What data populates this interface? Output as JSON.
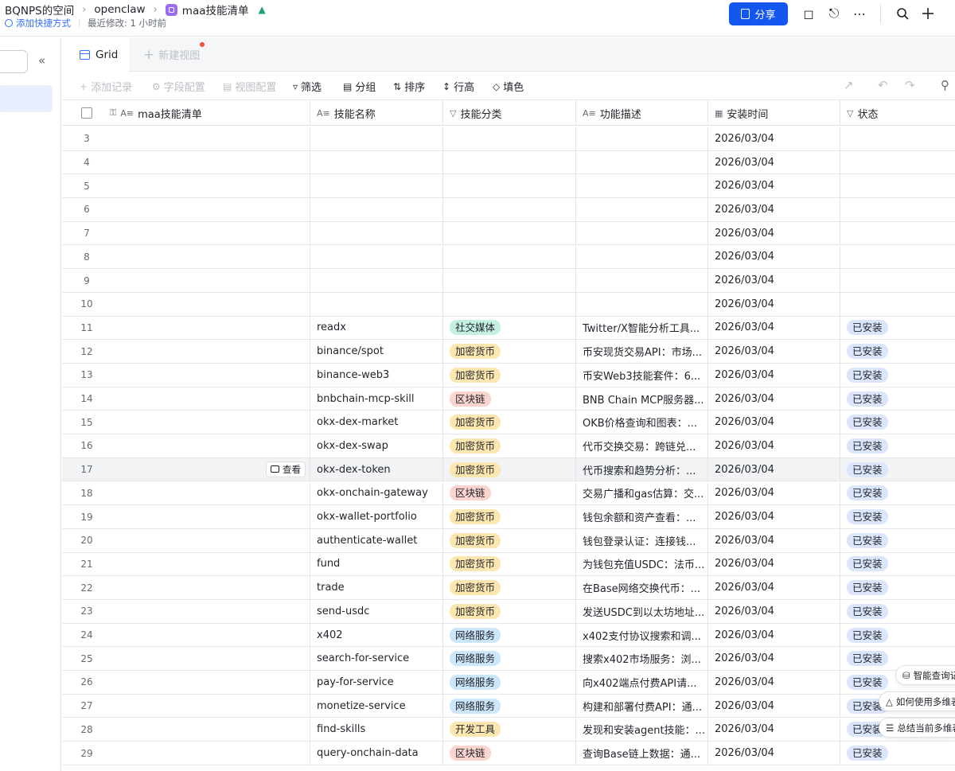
{
  "header": {
    "breadcrumb": [
      "BQNPS的空间",
      "openclaw",
      "maa技能清单"
    ],
    "add_shortcut": "添加快捷方式",
    "last_modified": "最近修改: 1 小时前",
    "share_label": "分享"
  },
  "views": {
    "active": "Grid",
    "new_view": "新建视图"
  },
  "toolbar": {
    "add_record": "添加记录",
    "field_config": "字段配置",
    "view_config": "视图配置",
    "filter": "筛选",
    "group": "分组",
    "sort": "排序",
    "row_height": "行高",
    "fill_color": "填色"
  },
  "columns": [
    "maa技能清单",
    "技能名称",
    "技能分类",
    "功能描述",
    "安装时间",
    "状态"
  ],
  "colors": {
    "accent": "#1456f0",
    "tag_social": "#c4efe3",
    "tag_crypto": "#fde7b0",
    "tag_chain": "#fbd4d0",
    "tag_net": "#cce6fb",
    "tag_dev": "#fde7b0",
    "tag_installed": "#dbe5fb"
  },
  "rows": [
    {
      "n": "3",
      "name": "",
      "cat": "",
      "desc": "",
      "date": "2026/03/04",
      "status": ""
    },
    {
      "n": "4",
      "name": "",
      "cat": "",
      "desc": "",
      "date": "2026/03/04",
      "status": ""
    },
    {
      "n": "5",
      "name": "",
      "cat": "",
      "desc": "",
      "date": "2026/03/04",
      "status": ""
    },
    {
      "n": "6",
      "name": "",
      "cat": "",
      "desc": "",
      "date": "2026/03/04",
      "status": ""
    },
    {
      "n": "7",
      "name": "",
      "cat": "",
      "desc": "",
      "date": "2026/03/04",
      "status": ""
    },
    {
      "n": "8",
      "name": "",
      "cat": "",
      "desc": "",
      "date": "2026/03/04",
      "status": ""
    },
    {
      "n": "9",
      "name": "",
      "cat": "",
      "desc": "",
      "date": "2026/03/04",
      "status": ""
    },
    {
      "n": "10",
      "name": "",
      "cat": "",
      "desc": "",
      "date": "2026/03/04",
      "status": ""
    },
    {
      "n": "11",
      "name": "readx",
      "cat": "社交媒体",
      "cat_color": "#c4efe3",
      "desc": "Twitter/X智能分析工具...",
      "date": "2026/03/04",
      "status": "已安装"
    },
    {
      "n": "12",
      "name": "binance/spot",
      "cat": "加密货币",
      "cat_color": "#fde7b0",
      "desc": "币安现货交易API：市场...",
      "date": "2026/03/04",
      "status": "已安装"
    },
    {
      "n": "13",
      "name": "binance-web3",
      "cat": "加密货币",
      "cat_color": "#fde7b0",
      "desc": "币安Web3技能套件：6...",
      "date": "2026/03/04",
      "status": "已安装"
    },
    {
      "n": "14",
      "name": "bnbchain-mcp-skill",
      "cat": "区块链",
      "cat_color": "#fbd4d0",
      "desc": "BNB Chain MCP服务器...",
      "date": "2026/03/04",
      "status": "已安装"
    },
    {
      "n": "15",
      "name": "okx-dex-market",
      "cat": "加密货币",
      "cat_color": "#fde7b0",
      "desc": "OKB价格查询和图表：...",
      "date": "2026/03/04",
      "status": "已安装"
    },
    {
      "n": "16",
      "name": "okx-dex-swap",
      "cat": "加密货币",
      "cat_color": "#fde7b0",
      "desc": "代币交换交易：跨链兑...",
      "date": "2026/03/04",
      "status": "已安装"
    },
    {
      "n": "17",
      "name": "okx-dex-token",
      "cat": "加密货币",
      "cat_color": "#fde7b0",
      "desc": "代币搜索和趋势分析：...",
      "date": "2026/03/04",
      "status": "已安装",
      "highlight": true,
      "view_label": "查看"
    },
    {
      "n": "18",
      "name": "okx-onchain-gateway",
      "cat": "区块链",
      "cat_color": "#fbd4d0",
      "desc": "交易广播和gas估算：交...",
      "date": "2026/03/04",
      "status": "已安装"
    },
    {
      "n": "19",
      "name": "okx-wallet-portfolio",
      "cat": "加密货币",
      "cat_color": "#fde7b0",
      "desc": "钱包余额和资产查看：...",
      "date": "2026/03/04",
      "status": "已安装"
    },
    {
      "n": "20",
      "name": "authenticate-wallet",
      "cat": "加密货币",
      "cat_color": "#fde7b0",
      "desc": "钱包登录认证：连接钱...",
      "date": "2026/03/04",
      "status": "已安装"
    },
    {
      "n": "21",
      "name": "fund",
      "cat": "加密货币",
      "cat_color": "#fde7b0",
      "desc": "为钱包充值USDC：法币...",
      "date": "2026/03/04",
      "status": "已安装"
    },
    {
      "n": "22",
      "name": "trade",
      "cat": "加密货币",
      "cat_color": "#fde7b0",
      "desc": "在Base网络交换代币：...",
      "date": "2026/03/04",
      "status": "已安装"
    },
    {
      "n": "23",
      "name": "send-usdc",
      "cat": "加密货币",
      "cat_color": "#fde7b0",
      "desc": "发送USDC到以太坊地址...",
      "date": "2026/03/04",
      "status": "已安装"
    },
    {
      "n": "24",
      "name": "x402",
      "cat": "网络服务",
      "cat_color": "#cce6fb",
      "desc": "x402支付协议搜索和调...",
      "date": "2026/03/04",
      "status": "已安装"
    },
    {
      "n": "25",
      "name": "search-for-service",
      "cat": "网络服务",
      "cat_color": "#cce6fb",
      "desc": "搜索x402市场服务：浏...",
      "date": "2026/03/04",
      "status": "已安装"
    },
    {
      "n": "26",
      "name": "pay-for-service",
      "cat": "网络服务",
      "cat_color": "#cce6fb",
      "desc": "向x402端点付费API请...",
      "date": "2026/03/04",
      "status": "已安装"
    },
    {
      "n": "27",
      "name": "monetize-service",
      "cat": "网络服务",
      "cat_color": "#cce6fb",
      "desc": "构建和部署付费API：通...",
      "date": "2026/03/04",
      "status": "已安装"
    },
    {
      "n": "28",
      "name": "find-skills",
      "cat": "开发工具",
      "cat_color": "#fde7b0",
      "desc": "发现和安装agent技能：...",
      "date": "2026/03/04",
      "status": "已安装"
    },
    {
      "n": "29",
      "name": "query-onchain-data",
      "cat": "区块链",
      "cat_color": "#fbd4d0",
      "desc": "查询Base链上数据：通...",
      "date": "2026/03/04",
      "status": "已安装"
    }
  ],
  "floating": [
    "智能查询记",
    "如何使用多维表",
    "总结当前多维表"
  ]
}
